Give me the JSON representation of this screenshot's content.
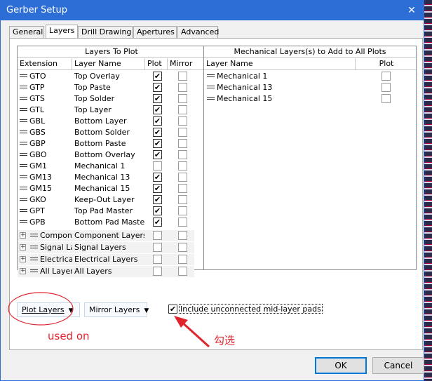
{
  "window": {
    "title": "Gerber Setup",
    "close_glyph": "✕"
  },
  "tabs": [
    {
      "label": "General",
      "active": false
    },
    {
      "label": "Layers",
      "active": true
    },
    {
      "label": "Drill Drawing",
      "active": false
    },
    {
      "label": "Apertures",
      "active": false
    },
    {
      "label": "Advanced",
      "active": false
    }
  ],
  "layers_to_plot": {
    "title": "Layers To Plot",
    "columns": {
      "extension": "Extension",
      "layer_name": "Layer Name",
      "plot": "Plot",
      "mirror": "Mirror"
    },
    "rows": [
      {
        "ext": "GTO",
        "name": "Top Overlay",
        "plot": true,
        "mirror": false
      },
      {
        "ext": "GTP",
        "name": "Top Paste",
        "plot": true,
        "mirror": false
      },
      {
        "ext": "GTS",
        "name": "Top Solder",
        "plot": true,
        "mirror": false
      },
      {
        "ext": "GTL",
        "name": "Top Layer",
        "plot": true,
        "mirror": false
      },
      {
        "ext": "GBL",
        "name": "Bottom Layer",
        "plot": true,
        "mirror": false
      },
      {
        "ext": "GBS",
        "name": "Bottom Solder",
        "plot": true,
        "mirror": false
      },
      {
        "ext": "GBP",
        "name": "Bottom Paste",
        "plot": true,
        "mirror": false
      },
      {
        "ext": "GBO",
        "name": "Bottom Overlay",
        "plot": true,
        "mirror": false
      },
      {
        "ext": "GM1",
        "name": "Mechanical 1",
        "plot": false,
        "mirror": false
      },
      {
        "ext": "GM13",
        "name": "Mechanical 13",
        "plot": true,
        "mirror": false
      },
      {
        "ext": "GM15",
        "name": "Mechanical 15",
        "plot": true,
        "mirror": false
      },
      {
        "ext": "GKO",
        "name": "Keep-Out Layer",
        "plot": true,
        "mirror": false
      },
      {
        "ext": "GPT",
        "name": "Top Pad Master",
        "plot": true,
        "mirror": false
      },
      {
        "ext": "GPB",
        "name": "Bottom Pad Master",
        "plot": true,
        "mirror": false
      }
    ],
    "groups": [
      {
        "ext": "Compon",
        "name": "Component Layers"
      },
      {
        "ext": "Signal La",
        "name": "Signal Layers"
      },
      {
        "ext": "Electrical",
        "name": "Electrical Layers"
      },
      {
        "ext": "All Layers",
        "name": "All Layers"
      }
    ]
  },
  "mechanical_layers": {
    "title": "Mechanical Layers(s) to Add to All Plots",
    "columns": {
      "layer_name": "Layer Name",
      "plot": "Plot"
    },
    "rows": [
      {
        "name": "Mechanical 1",
        "plot": false
      },
      {
        "name": "Mechanical 13",
        "plot": false
      },
      {
        "name": "Mechanical 15",
        "plot": false
      }
    ]
  },
  "buttons": {
    "plot_layers": "Plot Layers",
    "mirror_layers": "Mirror Layers",
    "ok": "OK",
    "cancel": "Cancel"
  },
  "include_unconnected": {
    "label": "Include unconnected mid-layer pads",
    "checked": true
  },
  "annotations": {
    "used_on": "used on",
    "tick_note": "勾选",
    "color": "#e0242e"
  }
}
